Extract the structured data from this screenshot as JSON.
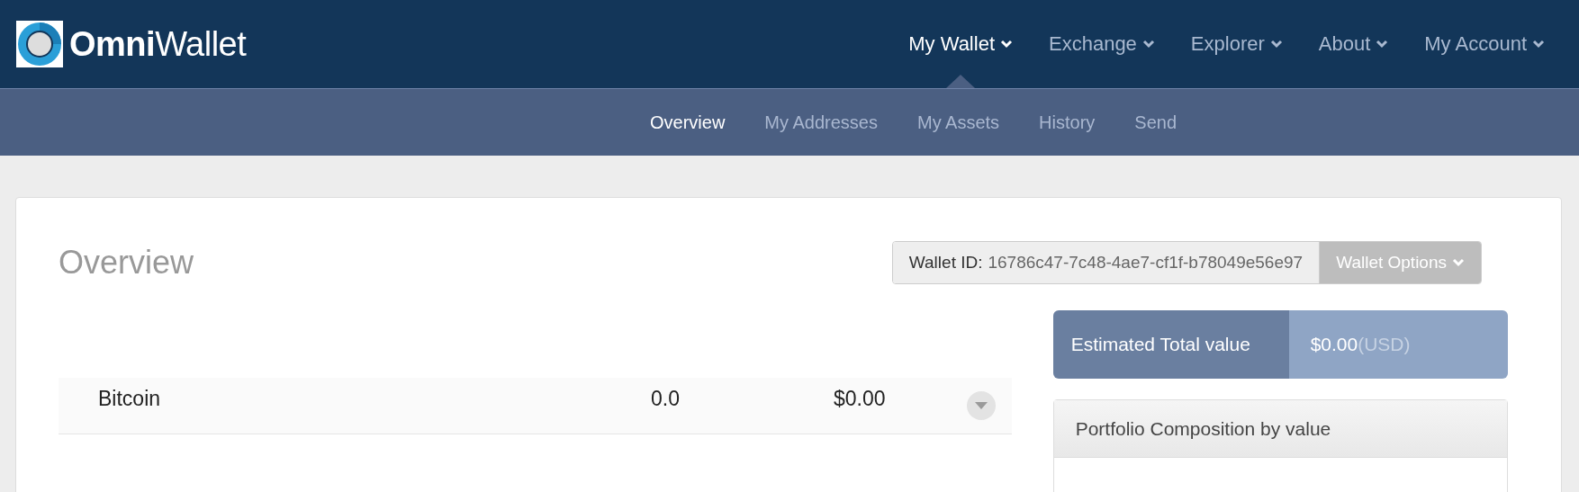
{
  "brand": {
    "name": "**Omni**Wallet"
  },
  "nav": [
    {
      "label": "My Wallet",
      "selected": true
    },
    {
      "label": "Exchange",
      "selected": false
    },
    {
      "label": "Explorer",
      "selected": false
    },
    {
      "label": "About",
      "selected": false
    },
    {
      "label": "My Account",
      "selected": false
    }
  ],
  "subnav": [
    {
      "label": "Overview",
      "selected": true
    },
    {
      "label": "My Addresses",
      "selected": false
    },
    {
      "label": "My Assets",
      "selected": false
    },
    {
      "label": "History",
      "selected": false
    },
    {
      "label": "Send",
      "selected": false
    }
  ],
  "page_title": "Overview",
  "wallet_id": {
    "label": "Wallet ID:",
    "value": "16786c47-7c48-4ae7-cf1f-b78049e56e97"
  },
  "wallet_options_button": "Wallet Options",
  "assets": [
    {
      "name": "Bitcoin",
      "amount": "0.0",
      "value": "$0.00"
    }
  ],
  "estimated": {
    "label": "Estimated Total value",
    "amount": "$0.00",
    "currency": "(USD)"
  },
  "portfolio": {
    "title": "Portfolio Composition by value"
  }
}
